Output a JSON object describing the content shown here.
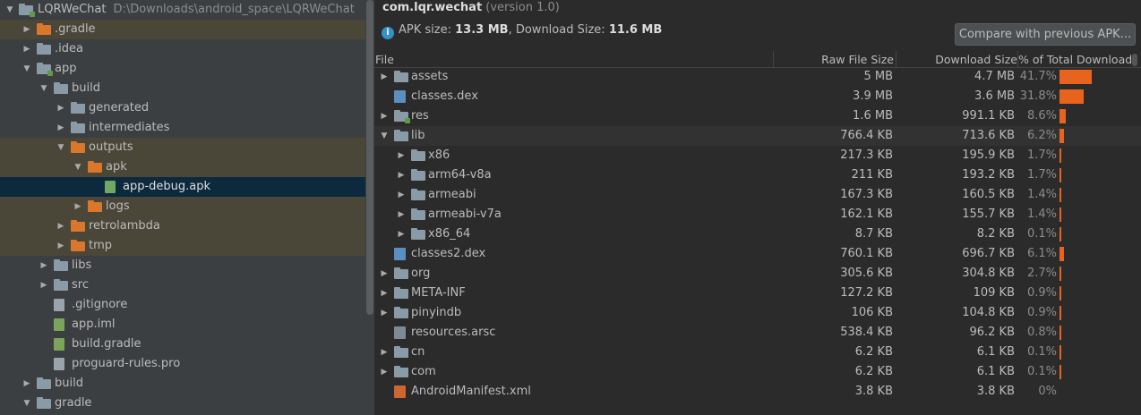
{
  "project": {
    "name": "LQRWeChat",
    "path": "D:\\Downloads\\android_space\\LQRWeChat"
  },
  "tree": [
    {
      "label": ".gradle",
      "depth": 1,
      "arrow": "right",
      "icon": "folder-orange",
      "hl": true
    },
    {
      "label": ".idea",
      "depth": 1,
      "arrow": "right",
      "icon": "folder"
    },
    {
      "label": "app",
      "depth": 1,
      "arrow": "down",
      "icon": "folder-module"
    },
    {
      "label": "build",
      "depth": 2,
      "arrow": "down",
      "icon": "folder"
    },
    {
      "label": "generated",
      "depth": 3,
      "arrow": "right",
      "icon": "folder"
    },
    {
      "label": "intermediates",
      "depth": 3,
      "arrow": "right",
      "icon": "folder"
    },
    {
      "label": "outputs",
      "depth": 3,
      "arrow": "down",
      "icon": "folder-orange",
      "hl": true
    },
    {
      "label": "apk",
      "depth": 4,
      "arrow": "down",
      "icon": "folder-orange",
      "hl": true
    },
    {
      "label": "app-debug.apk",
      "depth": 5,
      "arrow": "",
      "icon": "file-apk",
      "sel": true
    },
    {
      "label": "logs",
      "depth": 4,
      "arrow": "right",
      "icon": "folder-orange",
      "hl": true
    },
    {
      "label": "retrolambda",
      "depth": 3,
      "arrow": "right",
      "icon": "folder-orange",
      "hl": true
    },
    {
      "label": "tmp",
      "depth": 3,
      "arrow": "right",
      "icon": "folder-orange",
      "hl": true
    },
    {
      "label": "libs",
      "depth": 2,
      "arrow": "right",
      "icon": "folder"
    },
    {
      "label": "src",
      "depth": 2,
      "arrow": "right",
      "icon": "folder"
    },
    {
      "label": ".gitignore",
      "depth": 2,
      "arrow": "",
      "icon": "file"
    },
    {
      "label": "app.iml",
      "depth": 2,
      "arrow": "",
      "icon": "file-green"
    },
    {
      "label": "build.gradle",
      "depth": 2,
      "arrow": "",
      "icon": "file-green"
    },
    {
      "label": "proguard-rules.pro",
      "depth": 2,
      "arrow": "",
      "icon": "file"
    },
    {
      "label": "build",
      "depth": 1,
      "arrow": "right",
      "icon": "folder"
    },
    {
      "label": "gradle",
      "depth": 1,
      "arrow": "down",
      "icon": "folder"
    }
  ],
  "analyzer": {
    "package": "com.lqr.wechat",
    "version": "(version 1.0)",
    "apk_size_label": "APK size:",
    "apk_size": "13.3 MB",
    "download_size_label": ", Download Size:",
    "download_size": "11.6 MB",
    "compare_button": "Compare with previous APK...",
    "columns": {
      "file": "File",
      "raw": "Raw File Size",
      "download": "Download Size",
      "percent": "% of Total Download ..."
    },
    "rows": [
      {
        "name": "assets",
        "depth": 0,
        "arrow": "right",
        "icon": "folder",
        "raw": "5 MB",
        "dl": "4.7 MB",
        "pct": "41.7%",
        "frac": 0.417
      },
      {
        "name": "classes.dex",
        "depth": 0,
        "arrow": "",
        "icon": "dex",
        "raw": "3.9 MB",
        "dl": "3.6 MB",
        "pct": "31.8%",
        "frac": 0.318
      },
      {
        "name": "res",
        "depth": 0,
        "arrow": "right",
        "icon": "folder-res",
        "raw": "1.6 MB",
        "dl": "991.1 KB",
        "pct": "8.6%",
        "frac": 0.086
      },
      {
        "name": "lib",
        "depth": 0,
        "arrow": "down",
        "icon": "folder",
        "raw": "766.4 KB",
        "dl": "713.6 KB",
        "pct": "6.2%",
        "frac": 0.062,
        "hl": true
      },
      {
        "name": "x86",
        "depth": 1,
        "arrow": "right",
        "icon": "folder",
        "raw": "217.3 KB",
        "dl": "195.9 KB",
        "pct": "1.7%",
        "frac": 0.017
      },
      {
        "name": "arm64-v8a",
        "depth": 1,
        "arrow": "right",
        "icon": "folder",
        "raw": "211 KB",
        "dl": "193.2 KB",
        "pct": "1.7%",
        "frac": 0.017
      },
      {
        "name": "armeabi",
        "depth": 1,
        "arrow": "right",
        "icon": "folder",
        "raw": "167.3 KB",
        "dl": "160.5 KB",
        "pct": "1.4%",
        "frac": 0.014
      },
      {
        "name": "armeabi-v7a",
        "depth": 1,
        "arrow": "right",
        "icon": "folder",
        "raw": "162.1 KB",
        "dl": "155.7 KB",
        "pct": "1.4%",
        "frac": 0.014
      },
      {
        "name": "x86_64",
        "depth": 1,
        "arrow": "right",
        "icon": "folder",
        "raw": "8.7 KB",
        "dl": "8.2 KB",
        "pct": "0.1%",
        "frac": 0.001
      },
      {
        "name": "classes2.dex",
        "depth": 0,
        "arrow": "",
        "icon": "dex",
        "raw": "760.1 KB",
        "dl": "696.7 KB",
        "pct": "6.1%",
        "frac": 0.061
      },
      {
        "name": "org",
        "depth": 0,
        "arrow": "right",
        "icon": "folder",
        "raw": "305.6 KB",
        "dl": "304.8 KB",
        "pct": "2.7%",
        "frac": 0.027
      },
      {
        "name": "META-INF",
        "depth": 0,
        "arrow": "right",
        "icon": "folder",
        "raw": "127.2 KB",
        "dl": "109 KB",
        "pct": "0.9%",
        "frac": 0.009
      },
      {
        "name": "pinyindb",
        "depth": 0,
        "arrow": "right",
        "icon": "folder",
        "raw": "106 KB",
        "dl": "104.8 KB",
        "pct": "0.9%",
        "frac": 0.009
      },
      {
        "name": "resources.arsc",
        "depth": 0,
        "arrow": "",
        "icon": "arsc",
        "raw": "538.4 KB",
        "dl": "96.2 KB",
        "pct": "0.8%",
        "frac": 0.008
      },
      {
        "name": "cn",
        "depth": 0,
        "arrow": "right",
        "icon": "folder",
        "raw": "6.2 KB",
        "dl": "6.1 KB",
        "pct": "0.1%",
        "frac": 0.001
      },
      {
        "name": "com",
        "depth": 0,
        "arrow": "right",
        "icon": "folder",
        "raw": "6.2 KB",
        "dl": "6.1 KB",
        "pct": "0.1%",
        "frac": 0.001
      },
      {
        "name": "AndroidManifest.xml",
        "depth": 0,
        "arrow": "",
        "icon": "xml",
        "raw": "3.8 KB",
        "dl": "3.8 KB",
        "pct": "0%",
        "frac": 0
      }
    ]
  },
  "colors": {
    "bar": "#e8641e",
    "selection": "#0d293e",
    "excluded_folder_highlight": "#4a4638",
    "folder_orange": "#d9782d"
  }
}
